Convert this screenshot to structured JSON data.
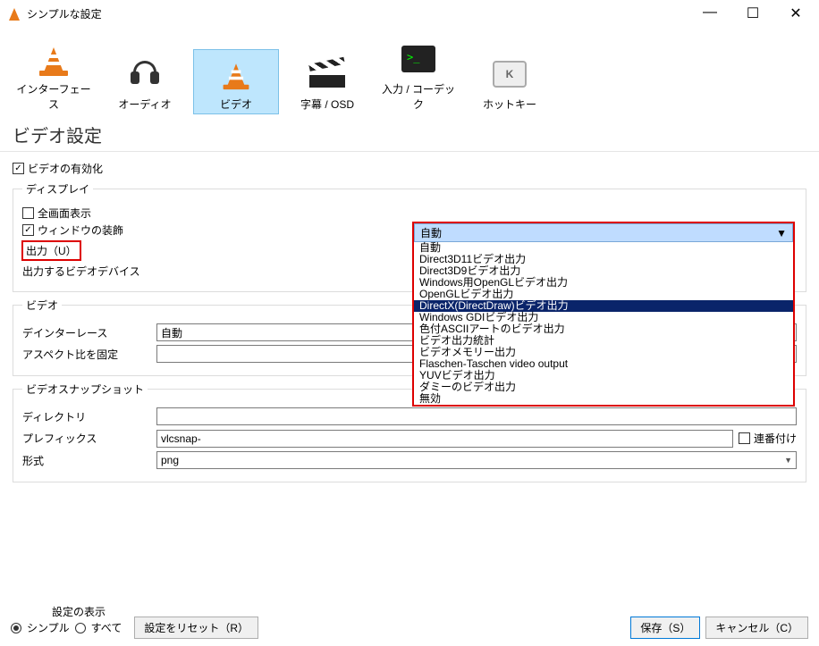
{
  "window": {
    "title": "シンプルな設定"
  },
  "tabs": [
    {
      "label": "インターフェース"
    },
    {
      "label": "オーディオ"
    },
    {
      "label": "ビデオ"
    },
    {
      "label": "字幕 / OSD"
    },
    {
      "label": "入力 / コーデック"
    },
    {
      "label": "ホットキー"
    }
  ],
  "page": {
    "title": "ビデオ設定"
  },
  "enable": {
    "label": "ビデオの有効化"
  },
  "display": {
    "legend": "ディスプレイ",
    "fullscreen": "全画面表示",
    "decorations": "ウィンドウの装飾",
    "output_label": "出力（U）",
    "output_device_label": "出力するビデオデバイス",
    "output_selected": "自動",
    "options": [
      "自動",
      "Direct3D11ビデオ出力",
      "Direct3D9ビデオ出力",
      "Windows用OpenGLビデオ出力",
      "OpenGLビデオ出力",
      "DirectX(DirectDraw)ビデオ出力",
      "Windows GDIビデオ出力",
      "色付ASCIIアートのビデオ出力",
      "ビデオ出力統計",
      "ビデオメモリー出力",
      "Flaschen-Taschen video output",
      "YUVビデオ出力",
      "ダミーのビデオ出力",
      "無効"
    ]
  },
  "video": {
    "legend": "ビデオ",
    "deinterlace_label": "デインターレース",
    "deinterlace_value": "自動",
    "aspect_label": "アスペクト比を固定",
    "aspect_value": ""
  },
  "snapshot": {
    "legend": "ビデオスナップショット",
    "dir_label": "ディレクトリ",
    "dir_value": "",
    "prefix_label": "プレフィックス",
    "prefix_value": "vlcsnap-",
    "seq_label": "連番付け",
    "format_label": "形式",
    "format_value": "png"
  },
  "footer": {
    "show_label": "設定の表示",
    "simple": "シンプル",
    "all": "すべて",
    "reset": "設定をリセット（R）",
    "save": "保存（S）",
    "cancel": "キャンセル（C）"
  }
}
